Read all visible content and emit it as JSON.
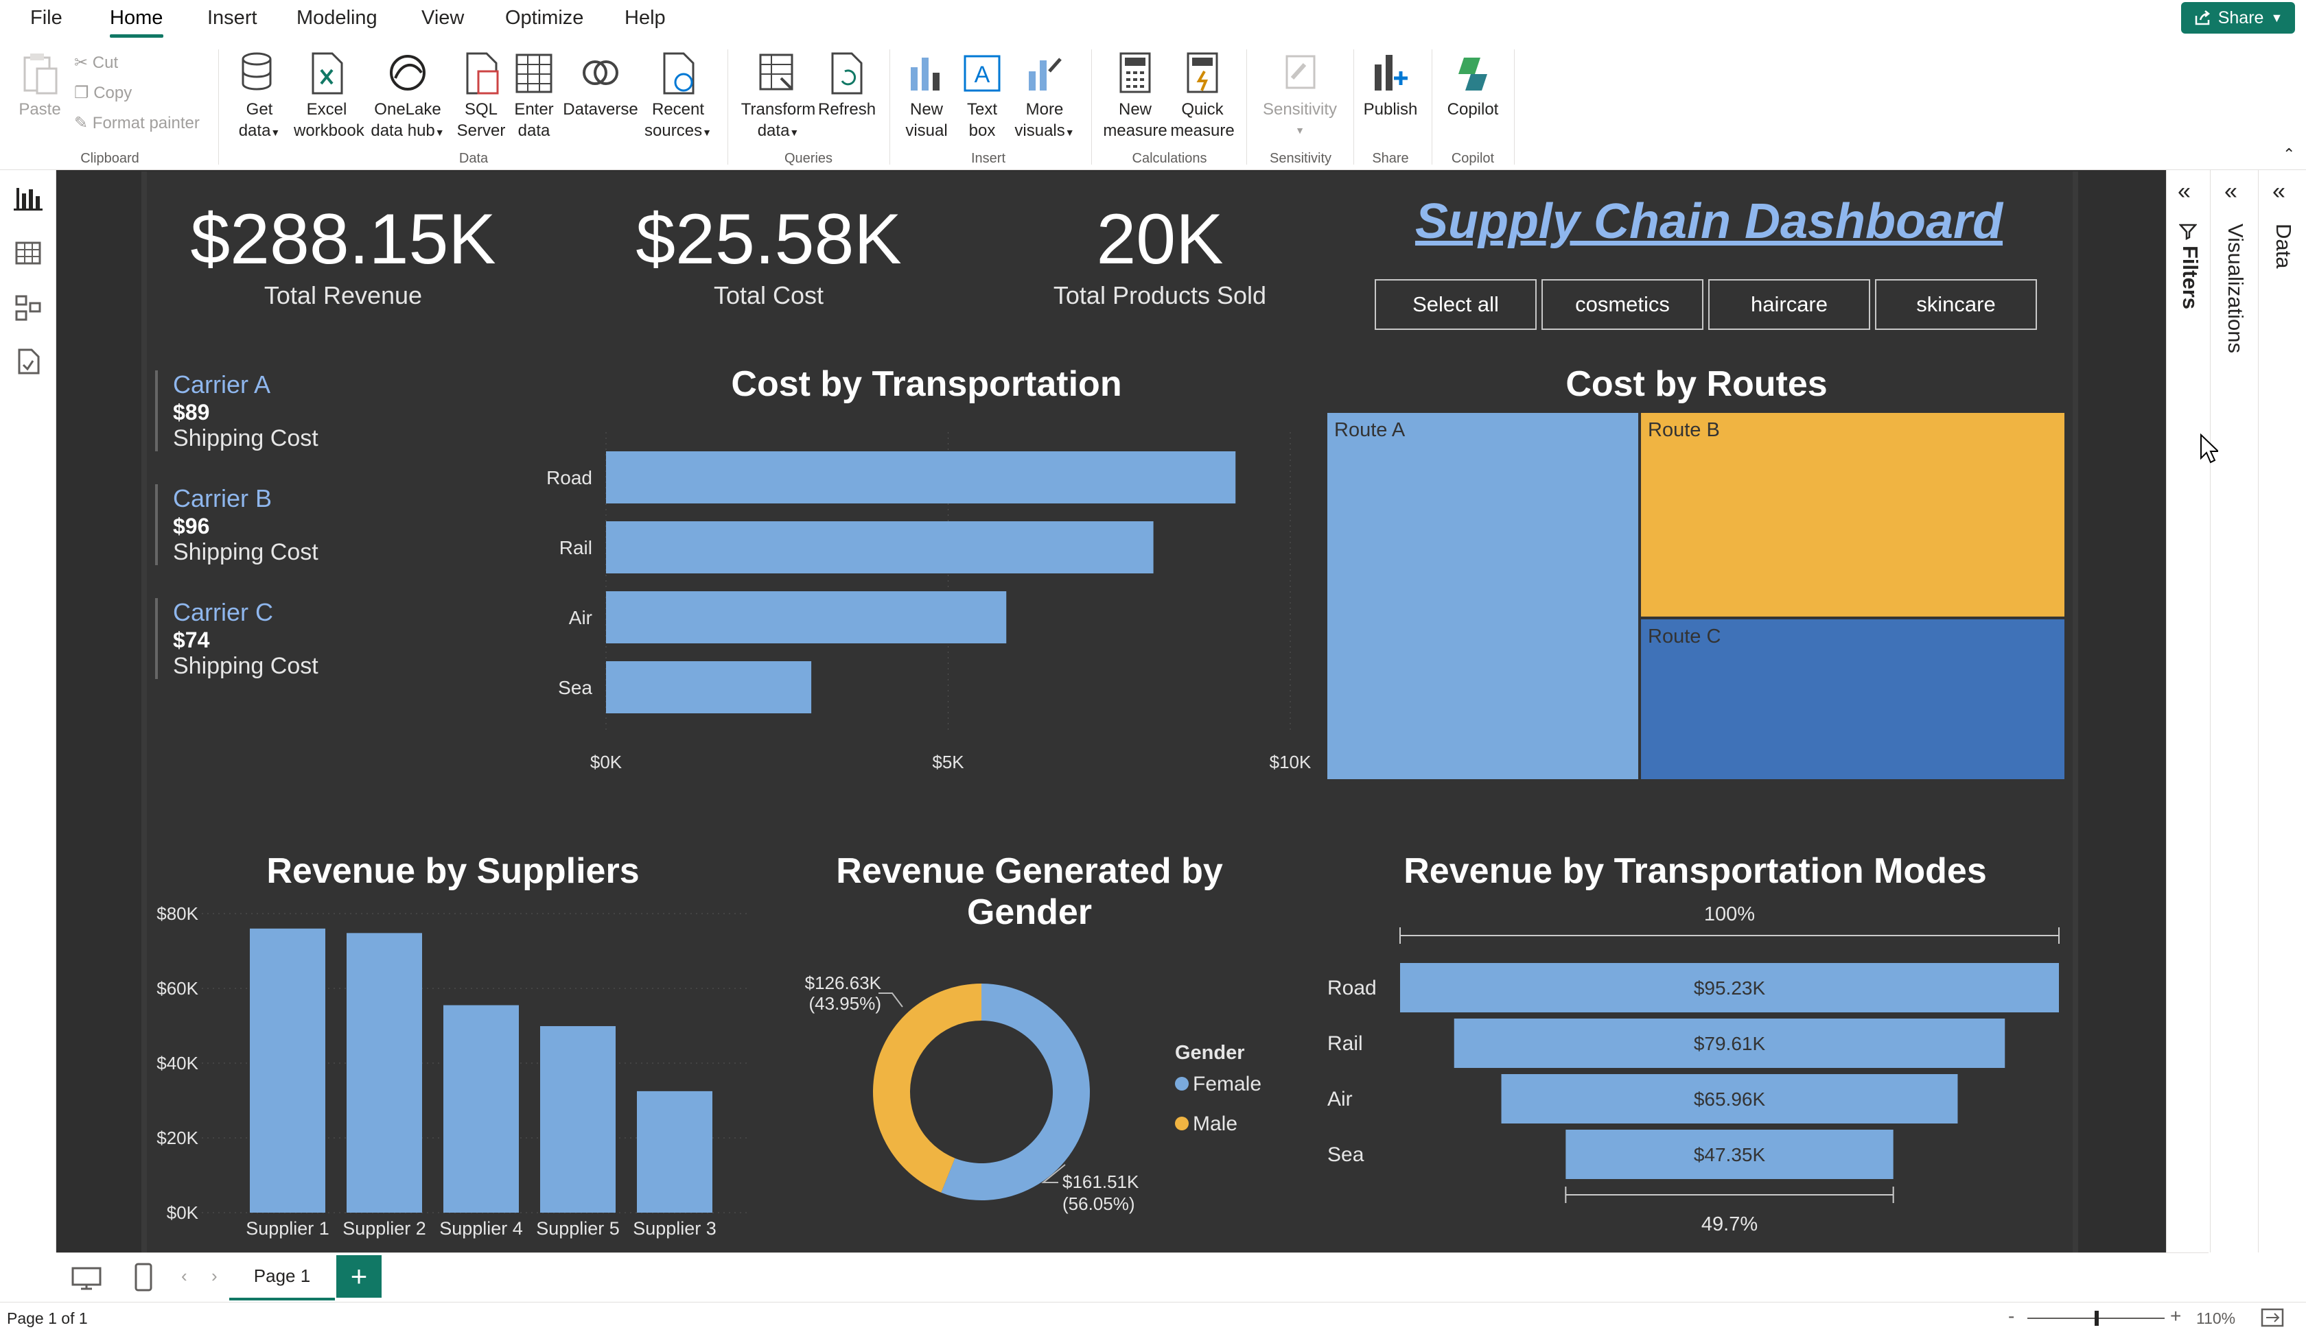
{
  "menu": {
    "file": "File",
    "home": "Home",
    "insert": "Insert",
    "modeling": "Modeling",
    "view": "View",
    "optimize": "Optimize",
    "help": "Help",
    "share": "Share"
  },
  "ribbon": {
    "paste": "Paste",
    "cut": "Cut",
    "copy": "Copy",
    "format_painter": "Format painter",
    "clipboard": "Clipboard",
    "get_data": [
      "Get",
      "data"
    ],
    "excel": [
      "Excel",
      "workbook"
    ],
    "onelake": [
      "OneLake",
      "data hub"
    ],
    "sql": [
      "SQL",
      "Server"
    ],
    "enter_data": [
      "Enter",
      "data"
    ],
    "dataverse": "Dataverse",
    "recent": [
      "Recent",
      "sources"
    ],
    "data_group": "Data",
    "transform": [
      "Transform",
      "data"
    ],
    "refresh": "Refresh",
    "queries_group": "Queries",
    "new_visual": [
      "New",
      "visual"
    ],
    "text_box": [
      "Text",
      "box"
    ],
    "more_visuals": [
      "More",
      "visuals"
    ],
    "insert_group": "Insert",
    "new_measure": [
      "New",
      "measure"
    ],
    "quick_measure": [
      "Quick",
      "measure"
    ],
    "calc_group": "Calculations",
    "sensitivity": "Sensitivity",
    "sens_group": "Sensitivity",
    "publish": "Publish",
    "share_group": "Share",
    "copilot": "Copilot",
    "copilot_group": "Copilot"
  },
  "panes": {
    "filters": "Filters",
    "visualizations": "Visualizations",
    "data": "Data"
  },
  "kpis": [
    {
      "value": "$288.15K",
      "label": "Total Revenue"
    },
    {
      "value": "$25.58K",
      "label": "Total Cost"
    },
    {
      "value": "20K",
      "label": "Total Products Sold"
    }
  ],
  "dashboard_title": "Supply Chain Dashboard",
  "slicer": [
    "Select all",
    "cosmetics",
    "haircare",
    "skincare"
  ],
  "carriers": [
    {
      "name": "Carrier A",
      "value": "$89",
      "label": "Shipping Cost"
    },
    {
      "name": "Carrier B",
      "value": "$96",
      "label": "Shipping Cost"
    },
    {
      "name": "Carrier C",
      "value": "$74",
      "label": "Shipping Cost"
    }
  ],
  "colors": {
    "bar": "#7aaadd",
    "routeA": "#7aaadd",
    "routeB": "#f0b442",
    "routeC": "#3f72b8",
    "male": "#f0b442",
    "female": "#7aaadd",
    "accent": "#117865"
  },
  "chart_data": [
    {
      "type": "bar",
      "orientation": "horizontal",
      "title": "Cost by Transportation",
      "categories": [
        "Road",
        "Rail",
        "Air",
        "Sea"
      ],
      "values": [
        9200,
        8000,
        5850,
        3000
      ],
      "xlim": [
        0,
        10000
      ],
      "xticks": [
        "$0K",
        "$5K",
        "$10K"
      ]
    },
    {
      "type": "treemap",
      "title": "Cost by Routes",
      "categories": [
        "Route A",
        "Route B",
        "Route C"
      ],
      "values": [
        11.6,
        8.9,
        7.0
      ]
    },
    {
      "type": "bar",
      "title": "Revenue by Suppliers",
      "categories": [
        "Supplier 1",
        "Supplier 2",
        "Supplier 4",
        "Supplier 5",
        "Supplier 3"
      ],
      "values": [
        76000,
        74800,
        55500,
        49900,
        32500
      ],
      "ylim": [
        0,
        80000
      ],
      "yticks": [
        "$0K",
        "$20K",
        "$40K",
        "$60K",
        "$80K"
      ]
    },
    {
      "type": "pie",
      "donut": true,
      "title": "Revenue Generated by Gender",
      "legend_title": "Gender",
      "slices": [
        {
          "name": "Female",
          "value": 161510,
          "label": "$161.51K",
          "pct": "(56.05%)"
        },
        {
          "name": "Male",
          "value": 126630,
          "label": "$126.63K",
          "pct": "(43.95%)"
        }
      ]
    },
    {
      "type": "funnel",
      "title": "Revenue by Transportation Modes",
      "categories": [
        "Road",
        "Rail",
        "Air",
        "Sea"
      ],
      "values": [
        95230,
        79610,
        65960,
        47350
      ],
      "labels": [
        "$95.23K",
        "$79.61K",
        "$65.96K",
        "$47.35K"
      ],
      "top_pct": "100%",
      "bottom_pct": "49.7%"
    }
  ],
  "pages": {
    "tab": "Page 1",
    "status": "Page 1 of 1",
    "zoom": "110%"
  }
}
